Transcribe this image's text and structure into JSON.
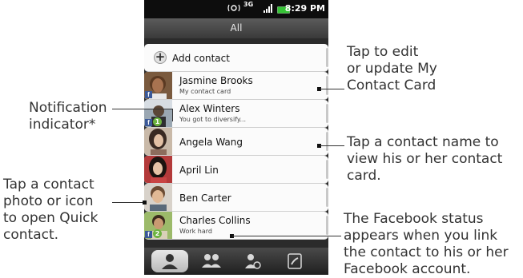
{
  "status_bar": {
    "time": "8:29 PM",
    "network": "3G"
  },
  "title": "All",
  "add_contact": {
    "label": "Add contact"
  },
  "contacts": [
    {
      "name": "Jasmine Brooks",
      "subtitle": "My contact card",
      "facebook": true
    },
    {
      "name": "Alex Winters",
      "subtitle": "You got to diversify...",
      "facebook": true,
      "notification_count": "1"
    },
    {
      "name": "Angela Wang"
    },
    {
      "name": "April Lin"
    },
    {
      "name": "Ben Carter"
    },
    {
      "name": "Charles Collins",
      "subtitle": "Work hard",
      "facebook": true,
      "notification_count": "2"
    }
  ],
  "tabs": [
    "person-icon",
    "groups-icon",
    "contact-search-icon",
    "call-history-icon"
  ],
  "annotations": {
    "notification": [
      "Notification",
      "indicator*"
    ],
    "photo": [
      "Tap a contact",
      "photo or icon",
      "to open Quick",
      "contact."
    ],
    "edit": [
      "Tap to edit",
      "or update My",
      "Contact Card"
    ],
    "name": [
      "Tap a contact name to",
      "view his or her contact",
      "card."
    ],
    "facebook": [
      "The Facebook status",
      "appears when you link",
      "the contact to his or her",
      "Facebook account."
    ]
  },
  "colors": {
    "facebook": "#3b5998",
    "notification": "#6cb33f",
    "battery": "#35c435"
  }
}
